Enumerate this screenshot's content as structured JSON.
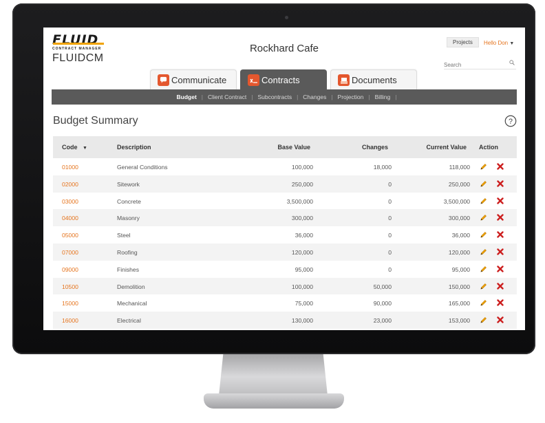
{
  "header": {
    "logo_word": "FLUID",
    "logo_tagline": "CONTRACT MANAGER",
    "app_name": "FLUIDCM",
    "project_title": "Rockhard Cafe",
    "projects_label": "Projects",
    "user_greeting": "Hello Don",
    "search_placeholder": "Search"
  },
  "tabs": [
    {
      "label": "Communicate",
      "icon": "speech-bubble-icon",
      "active": false
    },
    {
      "label": "Contracts",
      "icon": "signature-icon",
      "active": true
    },
    {
      "label": "Documents",
      "icon": "document-stack-icon",
      "active": false
    }
  ],
  "subnav": [
    "Budget",
    "Client Contract",
    "Subcontracts",
    "Changes",
    "Projection",
    "Billing"
  ],
  "subnav_active": "Budget",
  "page_title": "Budget Summary",
  "table": {
    "columns": [
      "Code",
      "Description",
      "Base Value",
      "Changes",
      "Current Value",
      "Action"
    ],
    "sort_column": "Code",
    "rows": [
      {
        "code": "01000",
        "description": "General Conditions",
        "base": "100,000",
        "changes": "18,000",
        "current": "118,000"
      },
      {
        "code": "02000",
        "description": "Sitework",
        "base": "250,000",
        "changes": "0",
        "current": "250,000"
      },
      {
        "code": "03000",
        "description": "Concrete",
        "base": "3,500,000",
        "changes": "0",
        "current": "3,500,000"
      },
      {
        "code": "04000",
        "description": "Masonry",
        "base": "300,000",
        "changes": "0",
        "current": "300,000"
      },
      {
        "code": "05000",
        "description": "Steel",
        "base": "36,000",
        "changes": "0",
        "current": "36,000"
      },
      {
        "code": "07000",
        "description": "Roofing",
        "base": "120,000",
        "changes": "0",
        "current": "120,000"
      },
      {
        "code": "09000",
        "description": "Finishes",
        "base": "95,000",
        "changes": "0",
        "current": "95,000"
      },
      {
        "code": "10500",
        "description": "Demolition",
        "base": "100,000",
        "changes": "50,000",
        "current": "150,000"
      },
      {
        "code": "15000",
        "description": "Mechanical",
        "base": "75,000",
        "changes": "90,000",
        "current": "165,000"
      },
      {
        "code": "16000",
        "description": "Electrical",
        "base": "130,000",
        "changes": "23,000",
        "current": "153,000"
      }
    ]
  },
  "colors": {
    "accent": "#e5731c",
    "nav_bg": "#5a5a5a",
    "delete": "#cc1f1f",
    "edit": "#f0a300"
  }
}
